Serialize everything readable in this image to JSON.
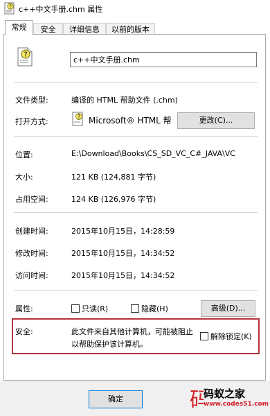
{
  "window": {
    "title": "c++中文手册.chm 属性"
  },
  "tabs": [
    {
      "label": "常规"
    },
    {
      "label": "安全"
    },
    {
      "label": "详细信息"
    },
    {
      "label": "以前的版本"
    }
  ],
  "general": {
    "file_name": "c++中文手册.chm",
    "file_type_label": "文件类型:",
    "file_type_value": "编译的 HTML 帮助文件 (.chm)",
    "open_with_label": "打开方式:",
    "open_with_value": "Microsoft® HTML 帮助",
    "change_button": "更改(C)...",
    "location_label": "位置:",
    "location_value": "E:\\Download\\Books\\CS_SD_VC_C#_JAVA\\VC",
    "size_label": "大小:",
    "size_value": "121 KB (124,881 字节)",
    "size_on_disk_label": "占用空间:",
    "size_on_disk_value": "124 KB (126,976 字节)",
    "created_label": "创建时间:",
    "created_value": "2015年10月15日，14:28:59",
    "modified_label": "修改时间:",
    "modified_value": "2015年10月15日，14:34:52",
    "accessed_label": "访问时间:",
    "accessed_value": "2015年10月15日，14:34:52",
    "attributes_label": "属性:",
    "readonly_label": "只读(R)",
    "hidden_label": "隐藏(H)",
    "advanced_button": "高级(D)...",
    "security_label": "安全:",
    "security_line1": "此文件来自其他计算机，可能被阻止",
    "security_line2": "以帮助保护该计算机。",
    "unblock_label": "解除锁定(K)"
  },
  "buttons": {
    "ok": "确定"
  },
  "watermark": {
    "brand": "码蚁之家",
    "url": "www.codes51.com"
  },
  "colors": {
    "highlight_border": "#b3323f",
    "watermark_red": "#d4202a"
  }
}
